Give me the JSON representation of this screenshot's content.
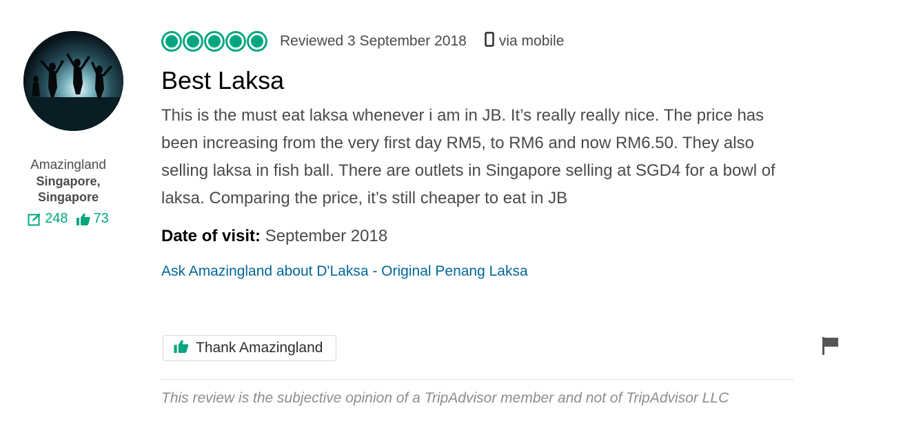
{
  "member": {
    "name": "Amazingland",
    "location": "Singapore, Singapore",
    "reviews_count": "248",
    "helpful_votes": "73"
  },
  "review": {
    "rating": 5,
    "rating_max": 5,
    "date": "Reviewed 3 September 2018",
    "via": "via mobile",
    "title": "Best Laksa",
    "body": "This is the must eat laksa whenever i am in JB. It’s really really nice. The price has been increasing from the very first day RM5, to RM6 and now RM6.50. They also selling laksa in fish ball. There are outlets in Singapore selling at SGD4 for a bowl of laksa. Comparing the price, it’s still cheaper to eat in JB",
    "visit_label": "Date of visit:",
    "visit_value": "September 2018",
    "ask_link": "Ask Amazingland about D'Laksa - Original Penang Laksa",
    "thank_button": "Thank Amazingland",
    "disclaimer": "This review is the subjective opinion of a TripAdvisor member and not of TripAdvisor LLC"
  },
  "icons": {
    "rating": "bubble-rating-icon",
    "mobile": "mobile-phone-icon",
    "reviews": "edit-pencil-icon",
    "votes": "thumbs-up-icon",
    "thank": "thumbs-up-icon",
    "report": "flag-icon"
  },
  "colors": {
    "brand_green": "#00a680",
    "link_blue": "#006699",
    "text": "#4a4a4a"
  }
}
